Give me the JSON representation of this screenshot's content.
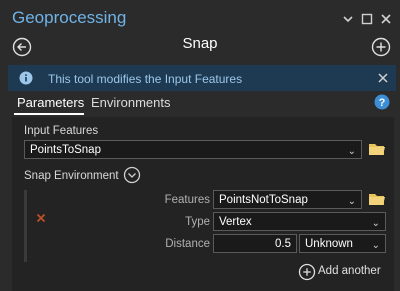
{
  "app": {
    "title": "Geoprocessing"
  },
  "header": {
    "title": "Snap"
  },
  "info": {
    "message": "This tool modifies the Input Features"
  },
  "tabs": [
    {
      "label": "Parameters"
    },
    {
      "label": "Environments"
    }
  ],
  "form": {
    "input_features": {
      "label": "Input Features",
      "value": "PointsToSnap"
    },
    "snap_environment": {
      "label": "Snap Environment",
      "features_label": "Features",
      "features_value": "PointsNotToSnap",
      "type_label": "Type",
      "type_value": "Vertex",
      "distance_label": "Distance",
      "distance_value": "0.5",
      "unit_value": "Unknown"
    },
    "add_another": "Add another"
  },
  "colors": {
    "accent": "#6fb3e8",
    "info_bg": "#1d3a52",
    "folder": "#e8c25a",
    "remove": "#c0502a"
  }
}
